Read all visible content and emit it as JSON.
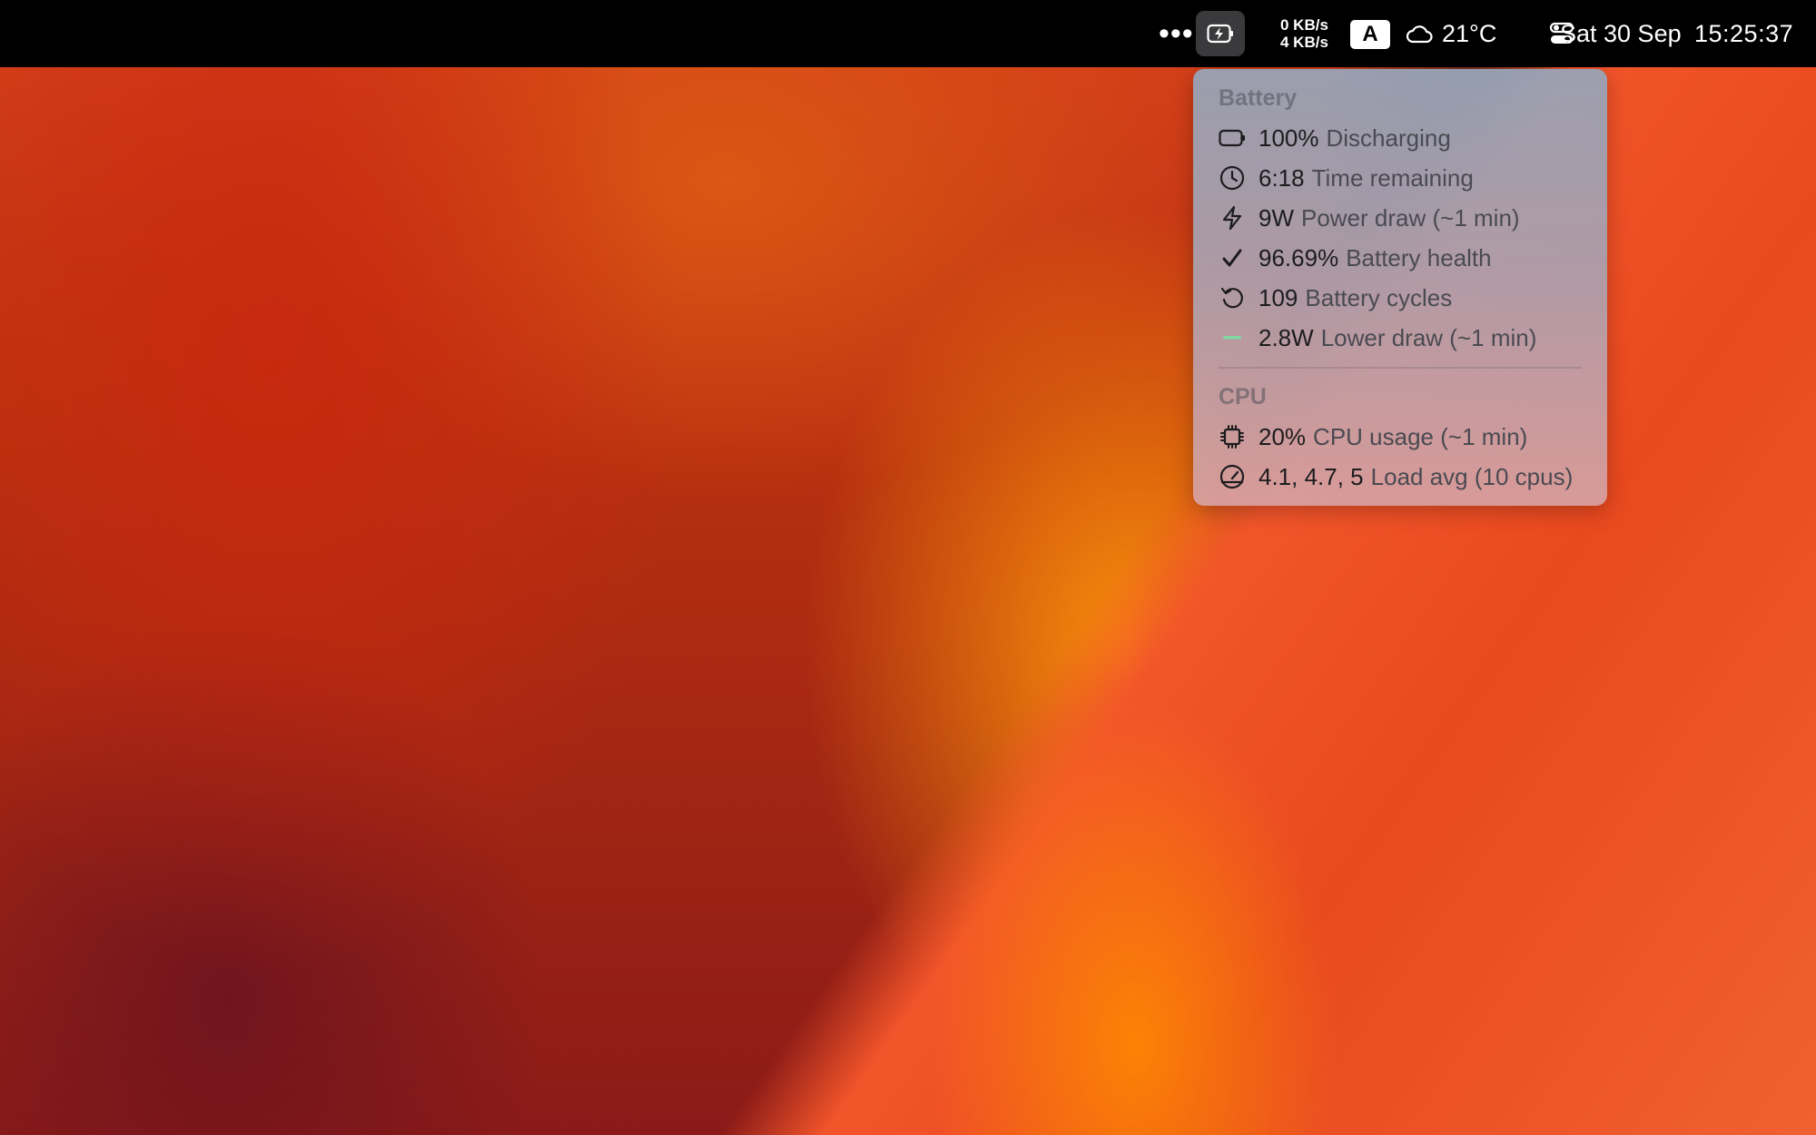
{
  "menubar": {
    "overflow_icon": "ellipsis-icon",
    "battery_icon": "battery-charging-icon",
    "net_down": "0 KB/s",
    "net_up": "4 KB/s",
    "input_source": "A",
    "weather_icon": "cloud-icon",
    "temperature": "21°C",
    "control_center_icon": "toggle-icon",
    "date": "Sat 30 Sep",
    "time": "15:25:37"
  },
  "popover": {
    "battery_section": {
      "title": "Battery",
      "rows": [
        {
          "icon": "battery-icon",
          "value": "100%",
          "label": "Discharging"
        },
        {
          "icon": "clock-icon",
          "value": "6:18",
          "label": "Time remaining"
        },
        {
          "icon": "bolt-icon",
          "value": "9W",
          "label": "Power draw (~1 min)"
        },
        {
          "icon": "checkmark-icon",
          "value": "96.69%",
          "label": "Battery health"
        },
        {
          "icon": "cycle-icon",
          "value": "109",
          "label": "Battery cycles"
        },
        {
          "icon": "dash-icon",
          "value": "2.8W",
          "label": "Lower draw (~1 min)"
        }
      ]
    },
    "cpu_section": {
      "title": "CPU",
      "rows": [
        {
          "icon": "chip-icon",
          "value": "20%",
          "label": "CPU usage (~1 min)"
        },
        {
          "icon": "gauge-icon",
          "value": "4.1, 4.7, 5",
          "label": "Load avg (10 cpus)"
        }
      ]
    }
  },
  "colors": {
    "menubar_bg": "#000000",
    "lower_draw_accent": "#7fd6a0"
  }
}
